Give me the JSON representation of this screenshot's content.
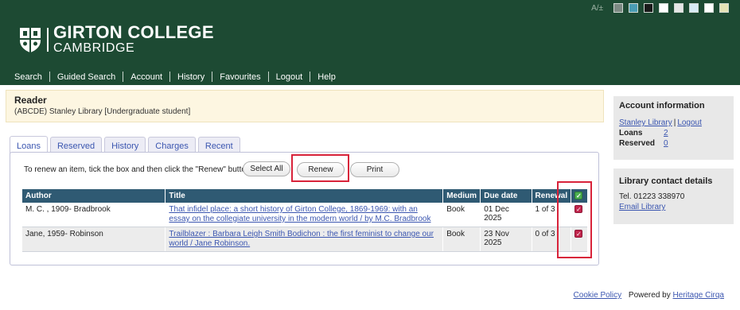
{
  "header": {
    "accessibility_text": "A/±",
    "swatches": [
      "#7d8a84",
      "#4a9db3",
      "#1a1a1a",
      "#ffffff",
      "#e6e6e6",
      "#d7ecf5",
      "#ffffff",
      "#e4e2b5"
    ],
    "logo_title": "GIRTON COLLEGE",
    "logo_subtitle": "CAMBRIDGE",
    "nav": [
      "Search",
      "Guided Search",
      "Account",
      "History",
      "Favourites",
      "Logout",
      "Help"
    ],
    "brand_color": "#1d4a33"
  },
  "reader": {
    "title": "Reader",
    "subtitle": "(ABCDE) Stanley Library [Undergraduate student]"
  },
  "tabs": [
    "Loans",
    "Reserved",
    "History",
    "Charges",
    "Recent"
  ],
  "loans": {
    "instruction": "To renew an item, tick the box and then click the \"Renew\" button",
    "select_all_label": "Select All",
    "renew_label": "Renew",
    "print_label": "Print",
    "columns": [
      "Author",
      "Title",
      "Medium",
      "Due date",
      "Renewal"
    ],
    "rows": [
      {
        "author": "M. C. , 1909- Bradbrook",
        "title": "That infidel place: a short history of Girton College, 1869-1969: with an essay on the collegiate university in the modern world / by M.C. Bradbrook",
        "medium": "Book",
        "due": "01 Dec 2025",
        "renewal": "1 of 3",
        "checked": true
      },
      {
        "author": "Jane, 1959- Robinson",
        "title": "Trailblazer : Barbara Leigh Smith Bodichon : the first feminist to change our world / Jane Robinson.",
        "medium": "Book",
        "due": "23 Nov 2025",
        "renewal": "0 of 3",
        "checked": true
      }
    ]
  },
  "account": {
    "title": "Account information",
    "library_link": "Stanley Library",
    "separator": "|",
    "logout_link": "Logout",
    "loans_label": "Loans",
    "loans_value": "2",
    "reserved_label": "Reserved",
    "reserved_value": "0"
  },
  "contact": {
    "title": "Library contact details",
    "tel": "Tel.  01223 338970",
    "email_link": "Email Library"
  },
  "footer": {
    "cookie": "Cookie Policy",
    "powered": "Powered by",
    "heritage": "Heritage Cirqa"
  },
  "highlight_color": "#d8233a"
}
